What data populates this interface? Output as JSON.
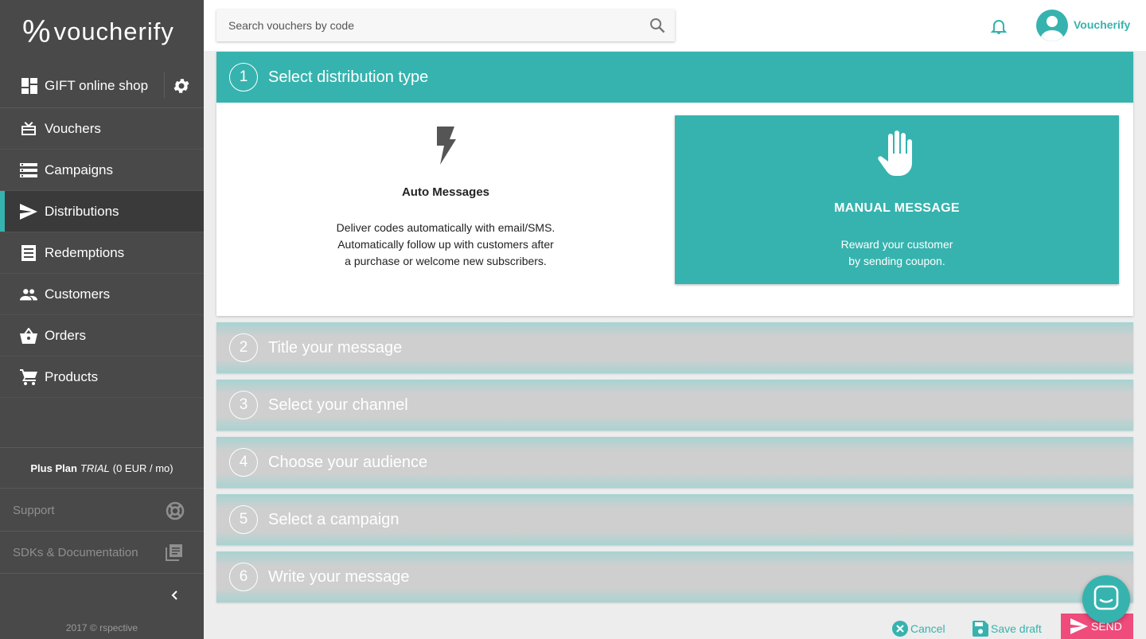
{
  "sidebar": {
    "logo_mark": "%",
    "logo_text": "voucherify",
    "shop_label": "GIFT online shop",
    "items": [
      {
        "label": "Vouchers"
      },
      {
        "label": "Campaigns"
      },
      {
        "label": "Distributions",
        "active": true
      },
      {
        "label": "Redemptions"
      },
      {
        "label": "Customers"
      },
      {
        "label": "Orders"
      },
      {
        "label": "Products"
      }
    ],
    "plan": {
      "name": "Plus Plan",
      "status": "TRIAL",
      "price": "(0 EUR / mo)"
    },
    "support": "Support",
    "docs": "SDKs & Documentation",
    "copyright": "2017 © rspective"
  },
  "topbar": {
    "search_placeholder": "Search vouchers by code",
    "username": "Voucherify"
  },
  "wizard": {
    "step1": {
      "num": "1",
      "title": "Select distribution type",
      "auto": {
        "title": "Auto Messages",
        "desc_line1": "Deliver codes automatically with email/SMS.",
        "desc_line2": "Automatically follow up with customers after",
        "desc_line3": "a purchase or welcome new subscribers."
      },
      "manual": {
        "title": "MANUAL MESSAGE",
        "desc_line1": "Reward your customer",
        "desc_line2": "by sending coupon."
      }
    },
    "steps": [
      {
        "num": "2",
        "title": "Title your message"
      },
      {
        "num": "3",
        "title": "Select your channel"
      },
      {
        "num": "4",
        "title": "Choose your audience"
      },
      {
        "num": "5",
        "title": "Select a campaign"
      },
      {
        "num": "6",
        "title": "Write your message"
      }
    ]
  },
  "actions": {
    "cancel": "Cancel",
    "save_draft": "Save draft",
    "send": "SEND"
  },
  "colors": {
    "accent": "#36b3ae",
    "sidebar": "#494949",
    "send": "#ef4b7b"
  }
}
